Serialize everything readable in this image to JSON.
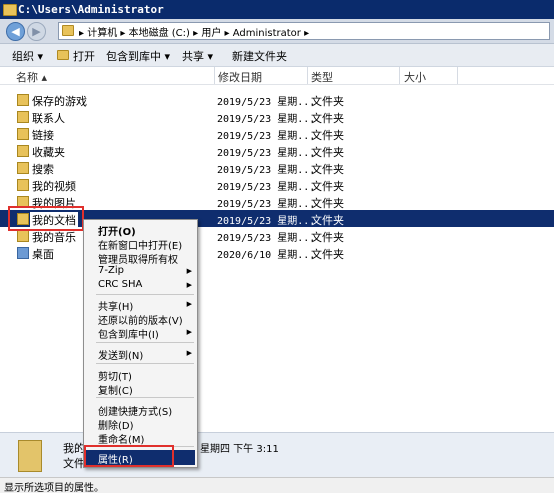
{
  "window": {
    "title": "C:\\Users\\Administrator"
  },
  "address": {
    "crumbs": [
      "计算机",
      "本地磁盘 (C:)",
      "用户",
      "Administrator"
    ]
  },
  "toolbar": {
    "organize": "组织 ▾",
    "open": "打开",
    "include": "包含到库中 ▾",
    "share": "共享 ▾",
    "new_folder": "新建文件夹"
  },
  "columns": {
    "name": "名称 ▴",
    "date": "修改日期",
    "type": "类型",
    "size": "大小"
  },
  "files": [
    {
      "name": "保存的游戏",
      "date": "2019/5/23 星期...",
      "type": "文件夹"
    },
    {
      "name": "联系人",
      "date": "2019/5/23 星期...",
      "type": "文件夹"
    },
    {
      "name": "链接",
      "date": "2019/5/23 星期...",
      "type": "文件夹"
    },
    {
      "name": "收藏夹",
      "date": "2019/5/23 星期...",
      "type": "文件夹"
    },
    {
      "name": "搜索",
      "date": "2019/5/23 星期...",
      "type": "文件夹"
    },
    {
      "name": "我的视频",
      "date": "2019/5/23 星期...",
      "type": "文件夹"
    },
    {
      "name": "我的图片",
      "date": "2019/5/23 星期...",
      "type": "文件夹"
    },
    {
      "name": "我的文档",
      "date": "2019/5/23 星期...",
      "type": "文件夹"
    },
    {
      "name": "我的音乐",
      "date": "2019/5/23 星期...",
      "type": "文件夹"
    },
    {
      "name": "桌面",
      "date": "2020/6/10 星期...",
      "type": "文件夹"
    }
  ],
  "menu": {
    "open": "打开(O)",
    "open_new": "在新窗口中打开(E)",
    "take_owner": "管理员取得所有权",
    "zip": "7-Zip",
    "crc": "CRC SHA",
    "share": "共享(H)",
    "restore": "还原以前的版本(V)",
    "include": "包含到库中(I)",
    "send_to": "发送到(N)",
    "cut": "剪切(T)",
    "copy": "复制(C)",
    "shortcut": "创建快捷方式(S)",
    "delete": "删除(D)",
    "rename": "重命名(M)",
    "properties": "属性(R)"
  },
  "details": {
    "name": "我的",
    "type": "文件",
    "date": "星期四 下午 3:11"
  },
  "status": {
    "text": "显示所选项目的属性。"
  }
}
